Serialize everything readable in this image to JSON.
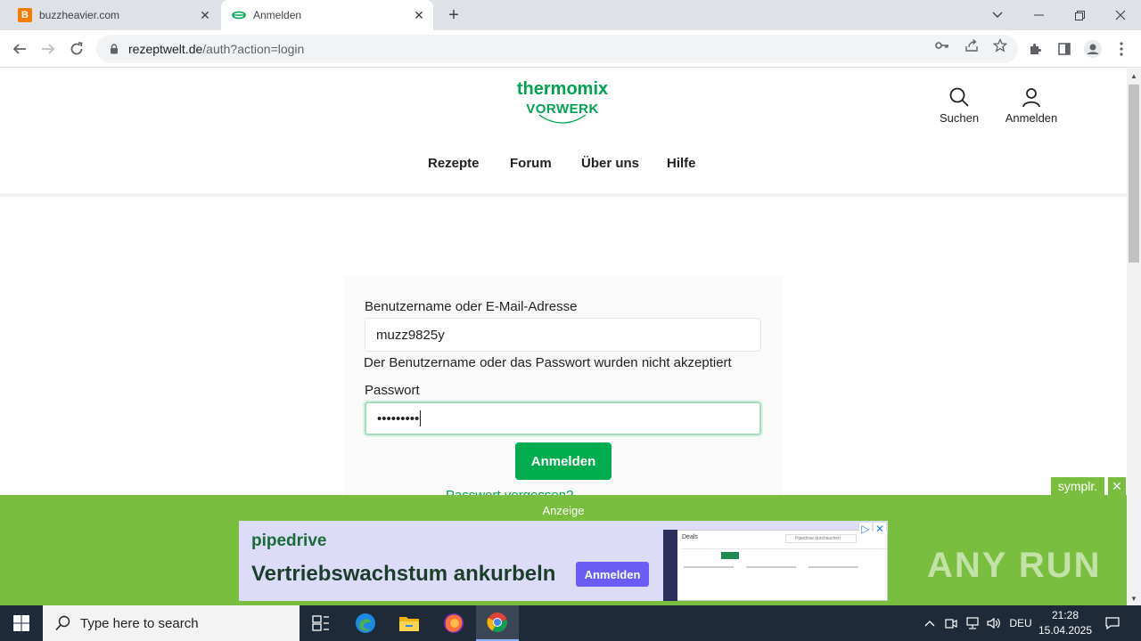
{
  "browser": {
    "tabs": [
      {
        "title": "buzzheavier.com",
        "favicon": "B"
      },
      {
        "title": "Anmelden"
      }
    ],
    "url_host": "rezeptwelt.de",
    "url_path": "/auth?action=login"
  },
  "site": {
    "brand_name": "thermomix",
    "brand_sub": "VORWERK",
    "search_label": "Suchen",
    "login_label": "Anmelden",
    "nav": [
      "Rezepte",
      "Forum",
      "Über uns",
      "Hilfe"
    ],
    "accent_color": "#00ac4e"
  },
  "login": {
    "username_label": "Benutzername oder E-Mail-Adresse",
    "username_value": "muzz9825y",
    "error_message": "Der Benutzername oder das Passwort wurden nicht akzeptiert",
    "password_label": "Passwort",
    "password_masked": "•••••••••",
    "submit_label": "Anmelden",
    "forgot_link": "Passwort vergessen?"
  },
  "ad": {
    "label": "Anzeige",
    "brand": "pipedrive",
    "headline": "Vertriebswachstum ankurbeln",
    "cta": "Anmelden",
    "provider": "symplr.",
    "close": "✕",
    "screenshot_title": "Deals",
    "screenshot_search": "Pipedrive durchsuchen"
  },
  "watermark": "ANY RUN",
  "taskbar": {
    "search_placeholder": "Type here to search",
    "language": "DEU",
    "time": "21:28",
    "date": "15.04.2025"
  }
}
